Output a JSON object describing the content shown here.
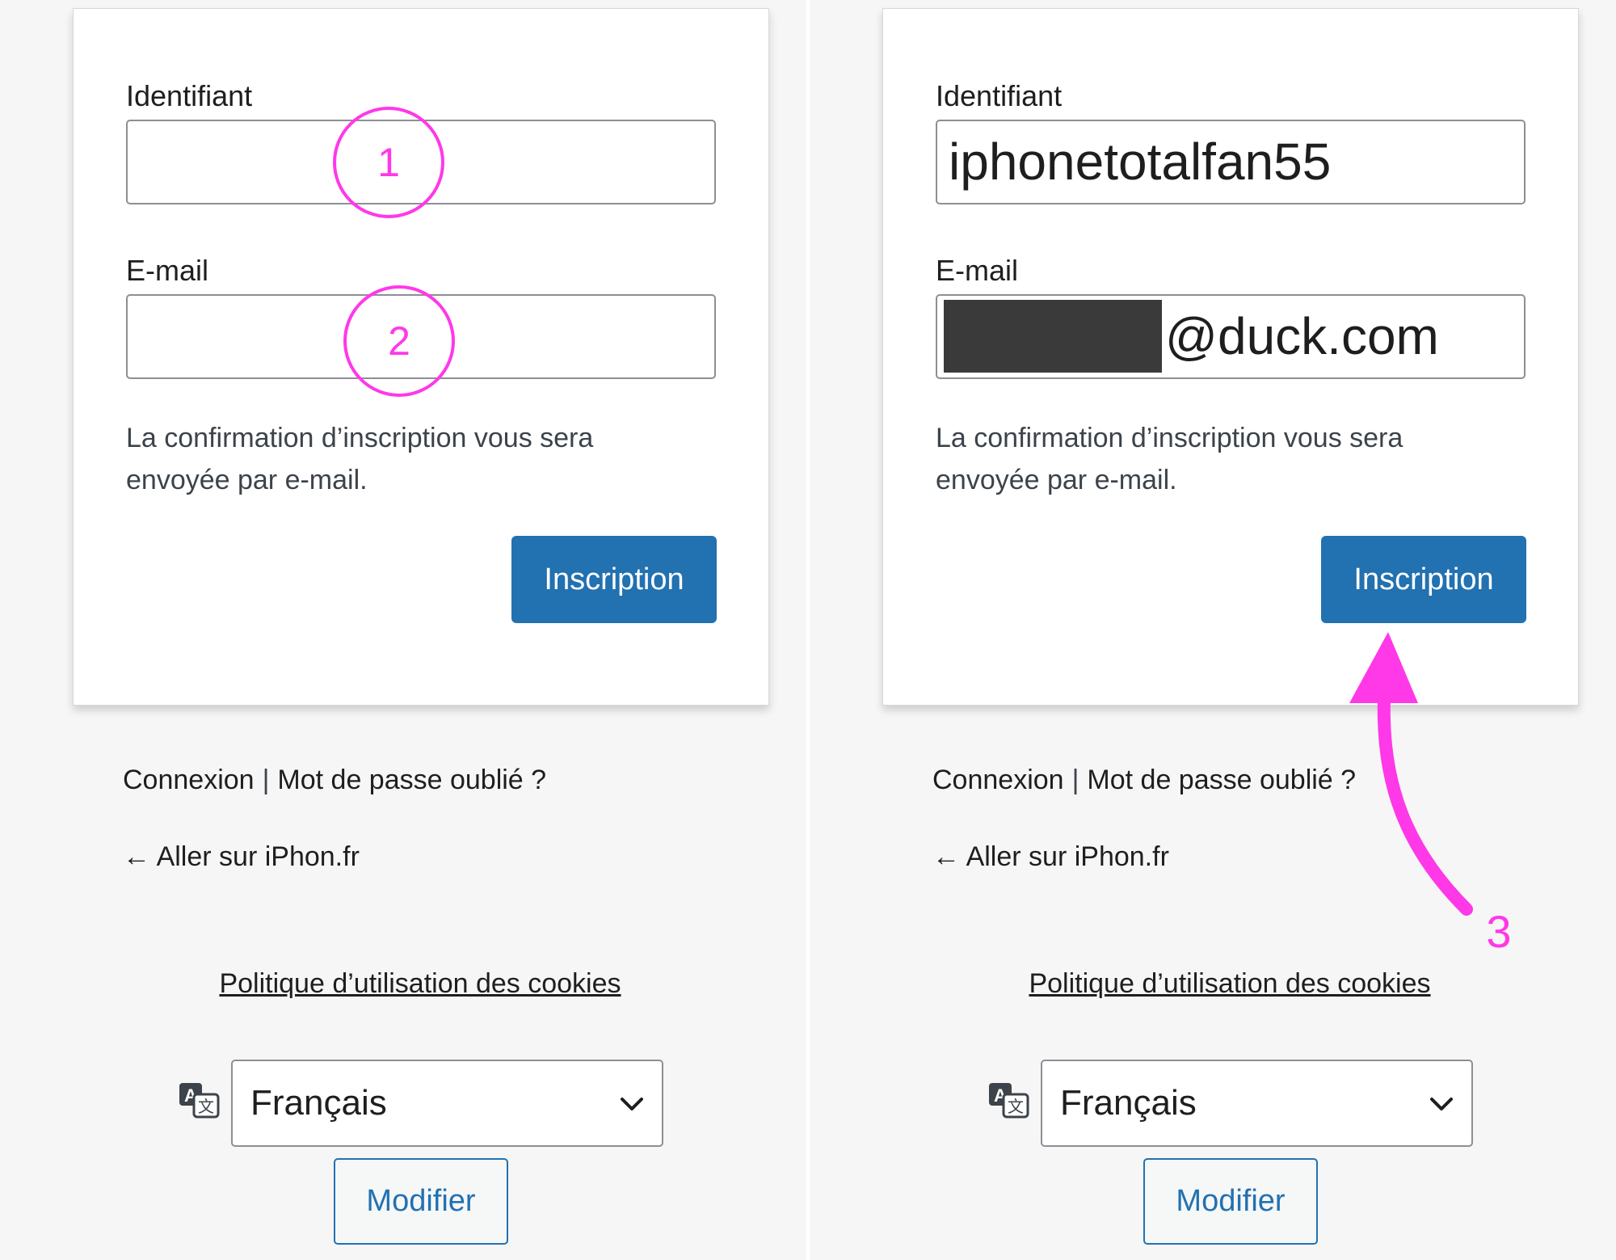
{
  "panels": {
    "left": {
      "username_label": "Identifiant",
      "username_value": "",
      "email_label": "E-mail",
      "email_value": "",
      "note_line1": "La confirmation d’inscription vous sera",
      "note_line2": "envoyée par e-mail.",
      "submit_label": "Inscription",
      "login_link": "Connexion",
      "separator": "|",
      "lost_password_link": "Mot de passe oublié ?",
      "back_link": "← Aller sur iPhon.fr",
      "cookies_link": "Politique d’utilisation des cookies",
      "language_selected": "Français",
      "change_button": "Modifier"
    },
    "right": {
      "username_label": "Identifiant",
      "username_value": "iphonetotalfan55",
      "email_label": "E-mail",
      "email_value": "@duck.com",
      "note_line1": "La confirmation d’inscription vous sera",
      "note_line2": "envoyée par e-mail.",
      "submit_label": "Inscription",
      "login_link": "Connexion",
      "separator": "|",
      "lost_password_link": "Mot de passe oublié ?",
      "back_link": "← Aller sur iPhon.fr",
      "cookies_link": "Politique d’utilisation des cookies",
      "language_selected": "Français",
      "change_button": "Modifier"
    }
  },
  "annotations": {
    "step1": "1",
    "step2": "2",
    "step3": "3",
    "color": "#ff38e8"
  },
  "colors": {
    "primary": "#2271b1",
    "background": "#f6f6f6",
    "redaction": "#3a3a3a"
  },
  "icons": {
    "language": "translation-icon",
    "dropdown": "chevron-down-icon",
    "redaction": "redaction-block"
  }
}
